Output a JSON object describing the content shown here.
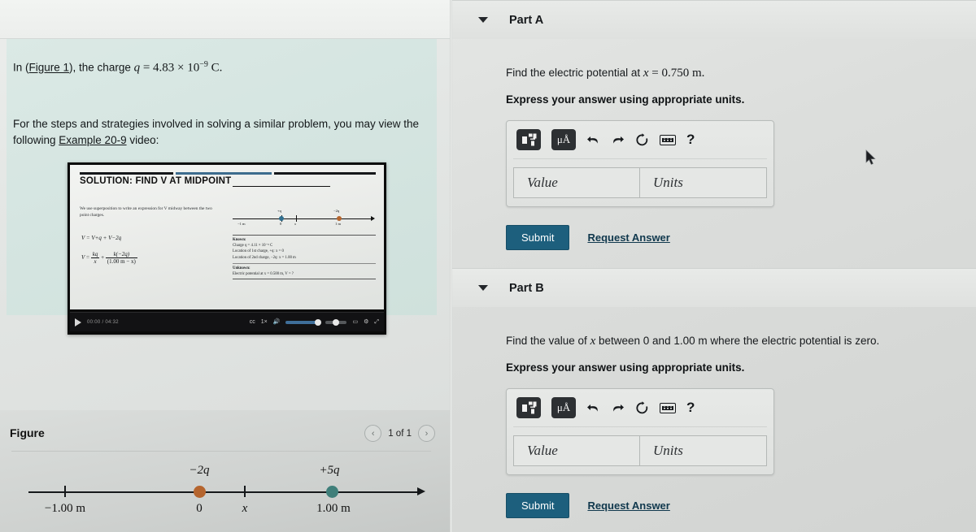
{
  "left": {
    "problem": {
      "line1_pre": "In (",
      "line1_link": "Figure 1",
      "line1_mid": "), the charge ",
      "line1_var": "q",
      "line1_eq": " = 4.83 × 10",
      "line1_exp": "−9",
      "line1_unit": " C.",
      "line2_pre": "For the steps and strategies involved in solving a similar problem, you may view the following ",
      "line2_link": "Example 20-9",
      "line2_post": " video:"
    },
    "video": {
      "slide_title": "SOLUTION:  FIND V AT MIDPOINT",
      "slide_paragraph": "We use superposition to write an expression for V midway between the two point charges.",
      "slide_eq1": "V = V+q + V−2q",
      "slide_eq_frac1_num": "kq",
      "slide_eq_frac1_den": "x",
      "slide_eq_frac2_num": "k(−2q)",
      "slide_eq_frac2_den": "(1.00 m − x)",
      "axis_left_label": "−1 m",
      "axis_zero_label": "0",
      "axis_x_label": "x",
      "axis_right_label": "1 m",
      "axis_charge_left": "+q",
      "axis_charge_right": "−2q",
      "known_title": "Known:",
      "known_l1": "Charge q = 4.11 × 10⁻⁹ C",
      "known_l2": "Location of 1st charge, +q:  x = 0",
      "known_l3": "Location of 2nd charge, −2q:  x = 1.00 m",
      "unknown_title": "Unknown:",
      "unknown_l1": "Electric potential at x = 0.500 m, V = ?",
      "time_display": "00:00 / 04:32"
    },
    "figure": {
      "title": "Figure",
      "prev_icon": "chevron-left-icon",
      "count": "1 of 1",
      "next_icon": "chevron-right-icon",
      "label_left": "−1.00 m",
      "label_zero": "0",
      "label_x": "x",
      "label_right": "1.00 m",
      "charge_left": "−2q",
      "charge_right": "+5q",
      "color_left_dot": "#b5652e",
      "color_right_dot": "#3f7f7a"
    }
  },
  "right": {
    "parts": [
      {
        "label": "Part A",
        "question_pre": "Find the electric potential at ",
        "question_var": "x",
        "question_post": " = 0.750 m.",
        "instruction": "Express your answer using appropriate units.",
        "toolbar": {
          "template_icon": "math-template-icon",
          "units_icon": "micro-angstrom-units-icon",
          "units_label": "μÅ",
          "undo_icon": "undo-icon",
          "redo_icon": "redo-icon",
          "reset_icon": "reset-icon",
          "keyboard_icon": "keyboard-icon",
          "help_icon": "help-icon",
          "help_label": "?"
        },
        "value_placeholder": "Value",
        "units_placeholder": "Units",
        "submit_label": "Submit",
        "request_label": "Request Answer"
      },
      {
        "label": "Part B",
        "question_pre": "Find the value of ",
        "question_var": "x",
        "question_post": " between 0 and 1.00 m where the electric potential is zero.",
        "instruction": "Express your answer using appropriate units.",
        "toolbar": {
          "template_icon": "math-template-icon",
          "units_icon": "micro-angstrom-units-icon",
          "units_label": "μÅ",
          "undo_icon": "undo-icon",
          "redo_icon": "redo-icon",
          "reset_icon": "reset-icon",
          "keyboard_icon": "keyboard-icon",
          "help_icon": "help-icon",
          "help_label": "?"
        },
        "value_placeholder": "Value",
        "units_placeholder": "Units",
        "submit_label": "Submit",
        "request_label": "Request Answer"
      }
    ]
  },
  "colors": {
    "submit_bg": "#1d5f7d",
    "link": "#10384d",
    "problem_bg": "#d5e5e1"
  }
}
